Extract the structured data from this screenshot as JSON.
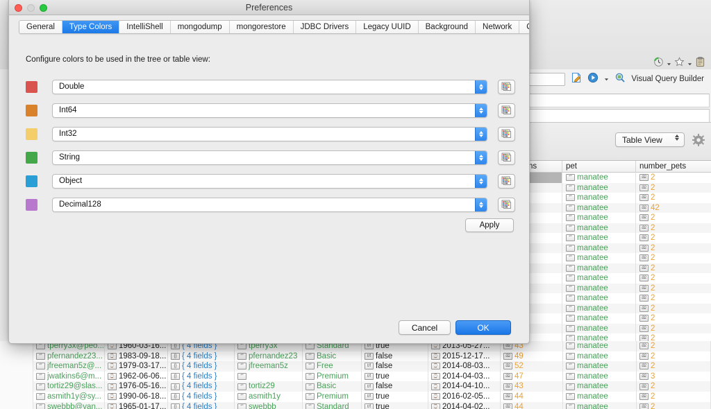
{
  "dialog": {
    "title": "Preferences",
    "window_controls": {
      "close": "close",
      "minimize": "minimize",
      "zoom": "zoom"
    },
    "tabs": [
      {
        "label": "General",
        "active": false
      },
      {
        "label": "Type Colors",
        "active": true
      },
      {
        "label": "IntelliShell",
        "active": false
      },
      {
        "label": "mongodump",
        "active": false
      },
      {
        "label": "mongorestore",
        "active": false
      },
      {
        "label": "JDBC Drivers",
        "active": false
      },
      {
        "label": "Legacy UUID",
        "active": false
      },
      {
        "label": "Background",
        "active": false
      },
      {
        "label": "Network",
        "active": false
      },
      {
        "label": "Online",
        "active": false
      }
    ],
    "hint": "Configure colors to be used in the tree or table view:",
    "color_rows": [
      {
        "type": "Double",
        "color": "#d9534f"
      },
      {
        "type": "Int64",
        "color": "#d9822b"
      },
      {
        "type": "Int32",
        "color": "#f3ce6a"
      },
      {
        "type": "String",
        "color": "#44a84a"
      },
      {
        "type": "Object",
        "color": "#2a9fd6"
      },
      {
        "type": "Decimal128",
        "color": "#b878cd"
      }
    ],
    "apply_label": "Apply",
    "cancel_label": "Cancel",
    "ok_label": "OK"
  },
  "background": {
    "toolbar": {
      "visual_query_builder_label": "Visual Query Builder",
      "icons": [
        "history-icon",
        "star-icon",
        "clipboard-icon",
        "edit-document-icon",
        "run-query-icon",
        "visual-query-builder-icon"
      ]
    },
    "view_select": {
      "value": "Table View"
    },
    "gear_label": "settings",
    "right_table": {
      "columns": [
        "ns",
        "pet",
        "number_pets"
      ],
      "rows": [
        {
          "pet": "manatee",
          "number_pets": "2",
          "selected": true
        },
        {
          "pet": "manatee",
          "number_pets": "2"
        },
        {
          "pet": "manatee",
          "number_pets": "2"
        },
        {
          "pet": "manatee",
          "number_pets": "42"
        },
        {
          "pet": "manatee",
          "number_pets": "2"
        },
        {
          "pet": "manatee",
          "number_pets": "2"
        },
        {
          "pet": "manatee",
          "number_pets": "2"
        },
        {
          "pet": "manatee",
          "number_pets": "2"
        },
        {
          "pet": "manatee",
          "number_pets": "2"
        },
        {
          "pet": "manatee",
          "number_pets": "2"
        },
        {
          "pet": "manatee",
          "number_pets": "2"
        },
        {
          "pet": "manatee",
          "number_pets": "2"
        },
        {
          "pet": "manatee",
          "number_pets": "2"
        },
        {
          "pet": "manatee",
          "number_pets": "2"
        },
        {
          "pet": "manatee",
          "number_pets": "2"
        },
        {
          "pet": "manatee",
          "number_pets": "2"
        },
        {
          "pet": "manatee",
          "number_pets": "2"
        },
        {
          "pet": "manatee",
          "number_pets": "2"
        }
      ]
    },
    "bottom_table": {
      "rows": [
        {
          "email": "tperry3x@peo...",
          "date": "1960-03-16...",
          "fields": "{ 4 fields }",
          "username": "tperry3x",
          "plan": "Standard",
          "bool": "true",
          "date2": "2013-05-27...",
          "num": "43",
          "pet": "manatee",
          "number_pets": "2"
        },
        {
          "email": "pfernandez23...",
          "date": "1983-09-18...",
          "fields": "{ 4 fields }",
          "username": "pfernandez23",
          "plan": "Basic",
          "bool": "false",
          "date2": "2015-12-17...",
          "num": "49",
          "pet": "manatee",
          "number_pets": "2"
        },
        {
          "email": "jfreeman5z@...",
          "date": "1979-03-17...",
          "fields": "{ 4 fields }",
          "username": "jfreeman5z",
          "plan": "Free",
          "bool": "false",
          "date2": "2014-08-03...",
          "num": "52",
          "pet": "manatee",
          "number_pets": "2"
        },
        {
          "email": "jwatkins6@m...",
          "date": "1962-06-06...",
          "fields": "{ 4 fields }",
          "username": "",
          "plan": "Premium",
          "bool": "true",
          "date2": "2014-04-03...",
          "num": "47",
          "pet": "manatee",
          "number_pets": "3"
        },
        {
          "email": "tortiz29@slas...",
          "date": "1976-05-16...",
          "fields": "{ 4 fields }",
          "username": "tortiz29",
          "plan": "Basic",
          "bool": "false",
          "date2": "2014-04-10...",
          "num": "43",
          "pet": "manatee",
          "number_pets": "2"
        },
        {
          "email": "asmith1y@sy...",
          "date": "1990-06-18...",
          "fields": "{ 4 fields }",
          "username": "asmith1y",
          "plan": "Premium",
          "bool": "true",
          "date2": "2016-02-05...",
          "num": "44",
          "pet": "manatee",
          "number_pets": "2"
        },
        {
          "email": "swebbb@van...",
          "date": "1965-01-17...",
          "fields": "{ 4 fields }",
          "username": "swebbb",
          "plan": "Standard",
          "bool": "true",
          "date2": "2014-04-02...",
          "num": "44",
          "pet": "manatee",
          "number_pets": "2"
        }
      ]
    }
  }
}
